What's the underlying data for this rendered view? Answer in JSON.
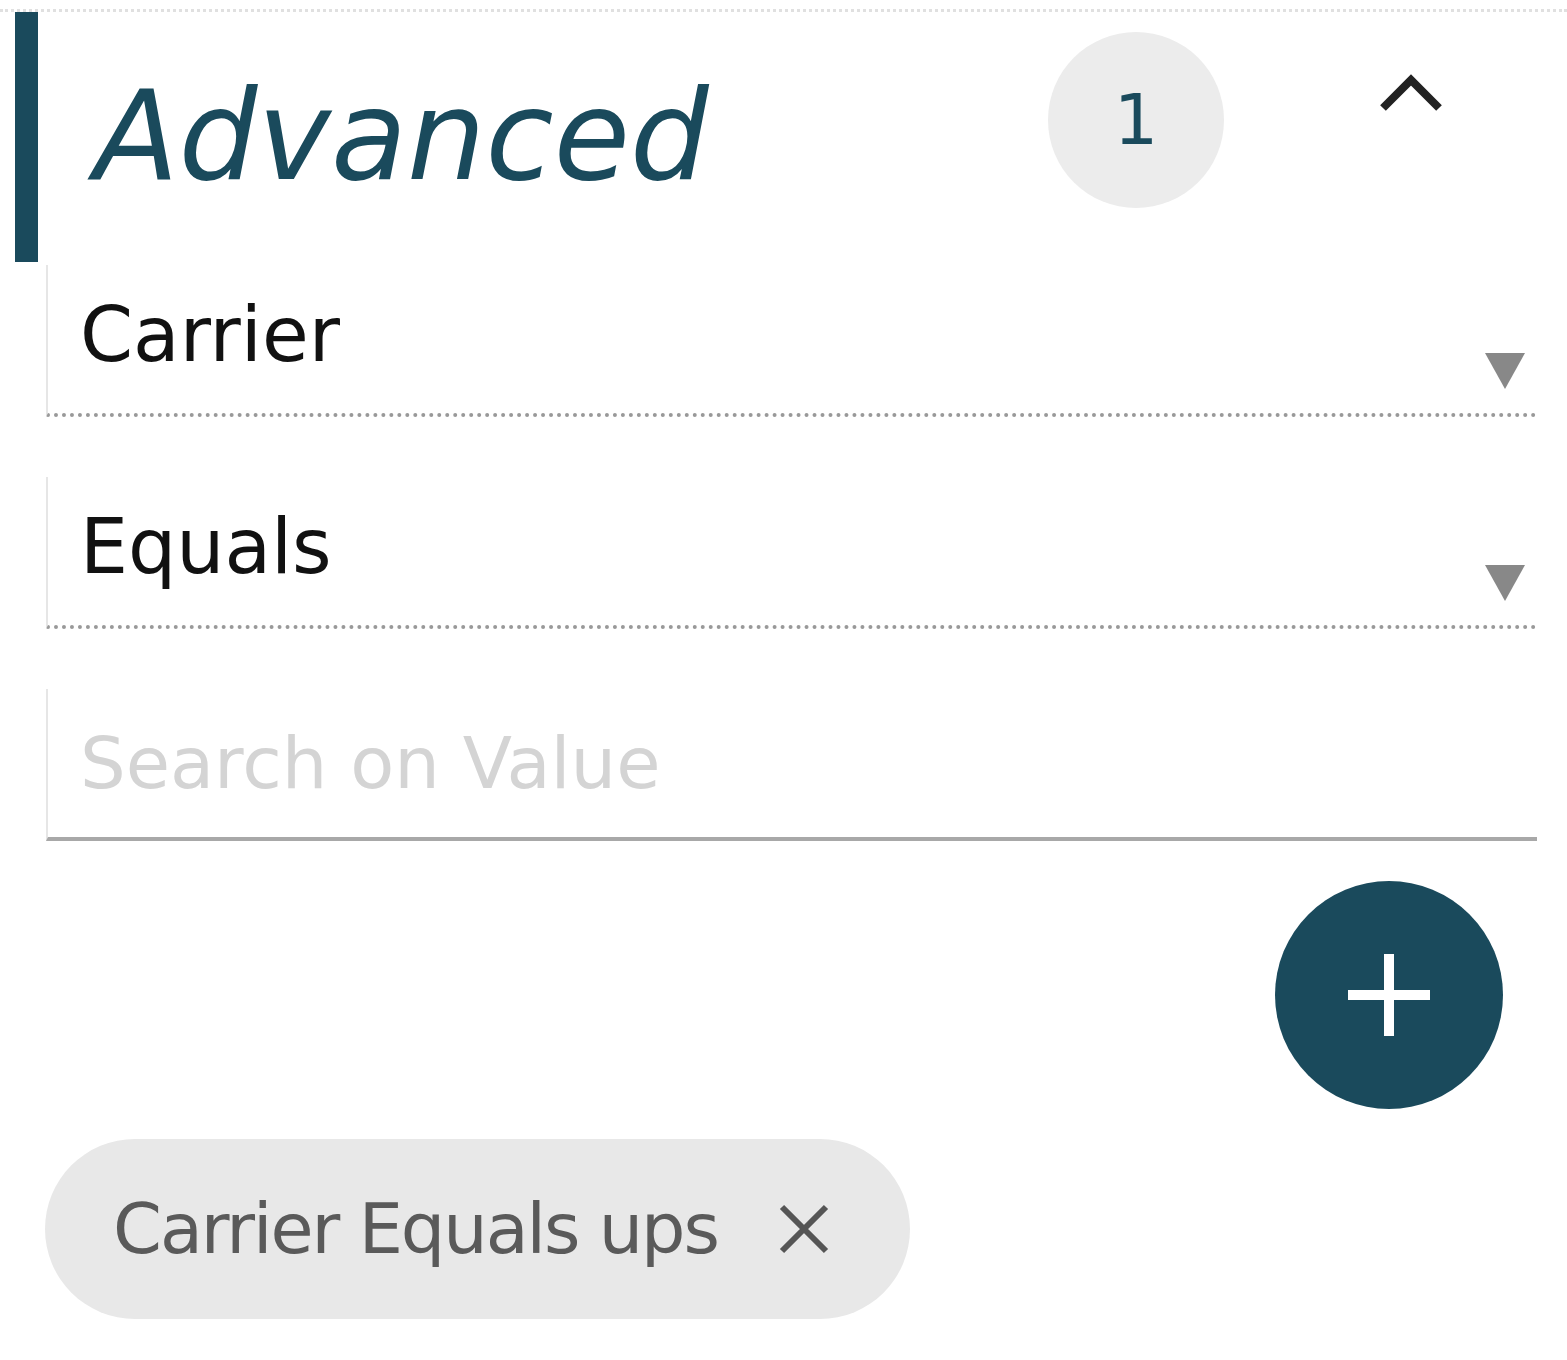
{
  "section": {
    "title": "Advanced",
    "badge": "1",
    "expanded": true
  },
  "fields": [
    {
      "kind": "dropdown",
      "value": "Carrier"
    },
    {
      "kind": "dropdown",
      "value": "Equals"
    },
    {
      "kind": "text",
      "placeholder": "Search on Value"
    }
  ],
  "chips": [
    {
      "label": "Carrier Equals ups"
    }
  ]
}
